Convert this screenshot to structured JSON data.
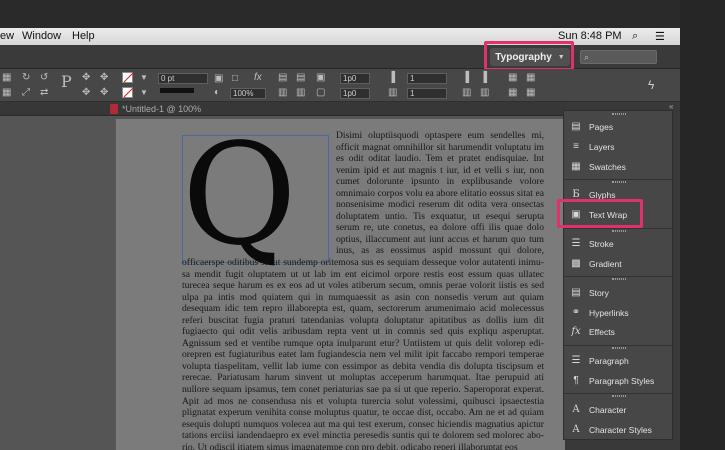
{
  "menubar": {
    "items": [
      "ew",
      "Window",
      "Help"
    ],
    "time": "Sun 8:48 PM"
  },
  "appbar": {
    "workspace": "Typography",
    "search_placeholder": ""
  },
  "controlbar": {
    "stroke_weight": "0 pt",
    "zoom": "100%",
    "value_1": "1p0",
    "value_2": "1",
    "value_3": "1p0",
    "value_4": "1"
  },
  "document": {
    "tab_title": "*Untitled-1 @ 100%",
    "drop_cap": "Q",
    "body_text": "Disimi  oluptiisquodi optaspere eum sendelles mi, officit magnat omnihillor sit harumendit voluptatu     im es odit oditat laudio. Tem et pratet endisquiae. Int venim ipid et aut magnis t  iur, id et velli   s iur, non cumet dolorunte ipsunto in explibusande volore omnimaio corpos volu     ea abore elitatio eossus sitat ea nonsenisime modici reserum dit odita vera      onsectas doluptatem untio. Tis exquatur, ut esequi serupta serum re, ute conetus,      ea dolore offi  ilis quae dolo optius, illaccument aut iunt accus et harum quo      tum inus, as as eossimus aspid mossunt qui dolore, officaerspe oditibus sit ut       sundemp oritemosa sus es sequiam desseque volor autatenti inimu-sa mendit fugit      oluptatem ut ut lab im ent eicimol orpore restis eost essum quas ullatec turecea seque      harum es ex eos ad ut voles atiberum secum, omnis perae volorit iistis es sed ulpa pa intis mod quiatem qui in numquaessit as asin con nonsedis verum aut quiam desequam idic tem repro illaborepta est, quam, sectorerum arumenimaio acid molecessus referi buscitat fugia praturi tatendanias volupta doluptatur apitatibus as dollis ium dit fugiaecto qui odit velis aribusdam repta vent ut in comnis sed quis expliqu asperuptat. Agnissum sed et ventibe rumque opta inulparunt etur? Untiistem ut quis delit volorep edi-orepren est fugiaturibus eatet lam fugiandescia nem vel milit ipit faccabo rempori temperae volupta tiaspelitam, vellit lab iume con essimpor as debita vendia dis dolupta tiscipsum et rerecae. Pariatusam harum sinvent ut moluptas acceperum harumquat. Itae perupuid ati nullore sequam ipsamus, tem conet periaturias sae pa si ut que reperio. Saperoporat experat. Apit ad mos ne consendusa nis et volupta turercia solut volessimi, quibusci ipsaectestia plignatat experum venihita conse moluptus quatur, te occae dist, occabo. Am ne et ad quiam esequis dolupti numquos volecea aut ma qui test exerum, consec hiciendis magnatius apictur tations erciisi iandendaepro ex evel minctia peresedis suntis qui te dolorem sed molorec abo-rio. Ut odiscil itiatem simus imagnatempe con pro debit, odicabo reperi illaboruptat eos"
  },
  "panel": {
    "items": [
      {
        "label": "Pages",
        "icon": "pages-icon"
      },
      {
        "label": "Layers",
        "icon": "layers-icon"
      },
      {
        "label": "Swatches",
        "icon": "swatches-icon"
      },
      {
        "label": "Glyphs",
        "icon": "glyphs-icon"
      },
      {
        "label": "Text Wrap",
        "icon": "text-wrap-icon"
      },
      {
        "label": "Stroke",
        "icon": "stroke-icon"
      },
      {
        "label": "Gradient",
        "icon": "gradient-icon"
      },
      {
        "label": "Story",
        "icon": "story-icon"
      },
      {
        "label": "Hyperlinks",
        "icon": "hyperlinks-icon"
      },
      {
        "label": "Effects",
        "icon": "effects-icon"
      },
      {
        "label": "Paragraph",
        "icon": "paragraph-icon"
      },
      {
        "label": "Paragraph Styles",
        "icon": "paragraph-styles-icon"
      },
      {
        "label": "Character",
        "icon": "character-icon"
      },
      {
        "label": "Character Styles",
        "icon": "character-styles-icon"
      }
    ]
  },
  "colors": {
    "highlight": "#e0316f",
    "background": "#2a2a2a",
    "page": "#7b7b7b"
  }
}
